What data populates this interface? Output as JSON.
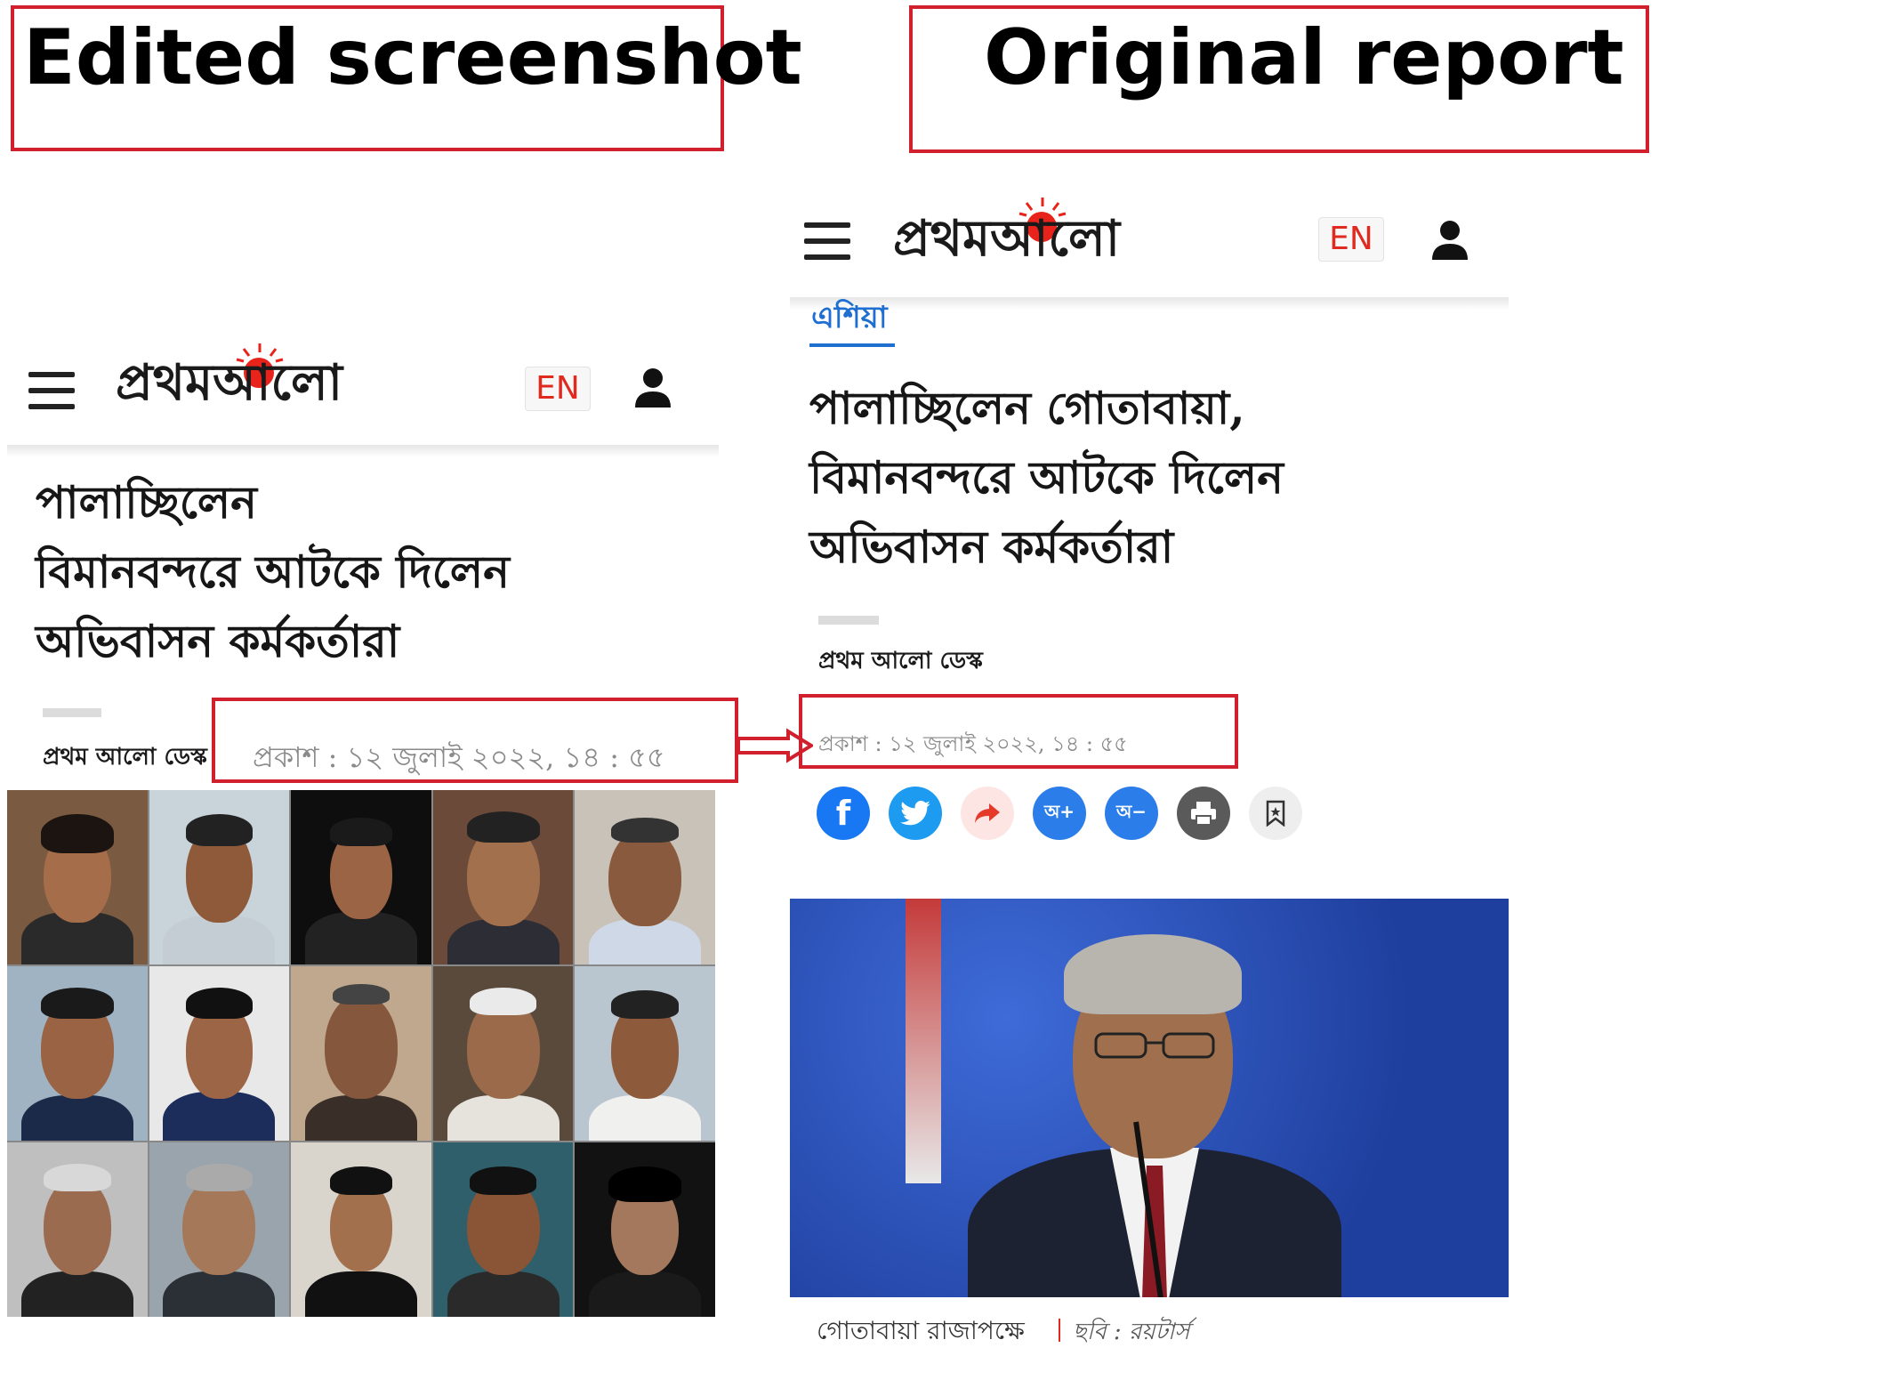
{
  "labels": {
    "left": "Edited screenshot",
    "right": "Original report"
  },
  "brand": {
    "logo_text": "প্রথমআলো",
    "language_button": "EN"
  },
  "edited": {
    "headline_lines": [
      "পালাচ্ছিলেন",
      "বিমানবন্দরে আটকে দিলেন",
      "অভিবাসন কর্মকর্তারা"
    ],
    "author": "প্রথম আলো ডেস্ক",
    "published": "প্রকাশ : ১২ জুলাই ২০২২, ১৪ : ৫৫",
    "photo_grid": {
      "rows": 3,
      "columns": 5
    }
  },
  "original": {
    "section": "এশিয়া",
    "headline_lines": [
      "পালাচ্ছিলেন গোতাবায়া,",
      "বিমানবন্দরে আটকে দিলেন",
      "অভিবাসন কর্মকর্তারা"
    ],
    "author": "প্রথম আলো ডেস্ক",
    "published": "প্রকাশ : ১২ জুলাই ২০২২, ১৪ : ৫৫",
    "share_buttons": [
      {
        "icon": "facebook-icon",
        "glyph": "f",
        "color": "#1877f2"
      },
      {
        "icon": "twitter-icon",
        "glyph": "🐦",
        "color": "#1d9bf0"
      },
      {
        "icon": "share-icon",
        "glyph": "➦",
        "color": "#fde5e3"
      },
      {
        "icon": "font-increase-icon",
        "glyph": "অ+",
        "color": "#2b7de9"
      },
      {
        "icon": "font-decrease-icon",
        "glyph": "অ−",
        "color": "#2b7de9"
      },
      {
        "icon": "print-icon",
        "glyph": "⎙",
        "color": "#5a5a5a"
      },
      {
        "icon": "bookmark-icon",
        "glyph": "⛉",
        "color": "#eeeeee"
      }
    ],
    "photo_caption": "গোতাবায়া রাজাপক্ষে",
    "photo_credit": "ছবি : রয়টার্স"
  },
  "colors": {
    "highlight_red": "#d0202e",
    "logo_sun": "#e8231c"
  }
}
